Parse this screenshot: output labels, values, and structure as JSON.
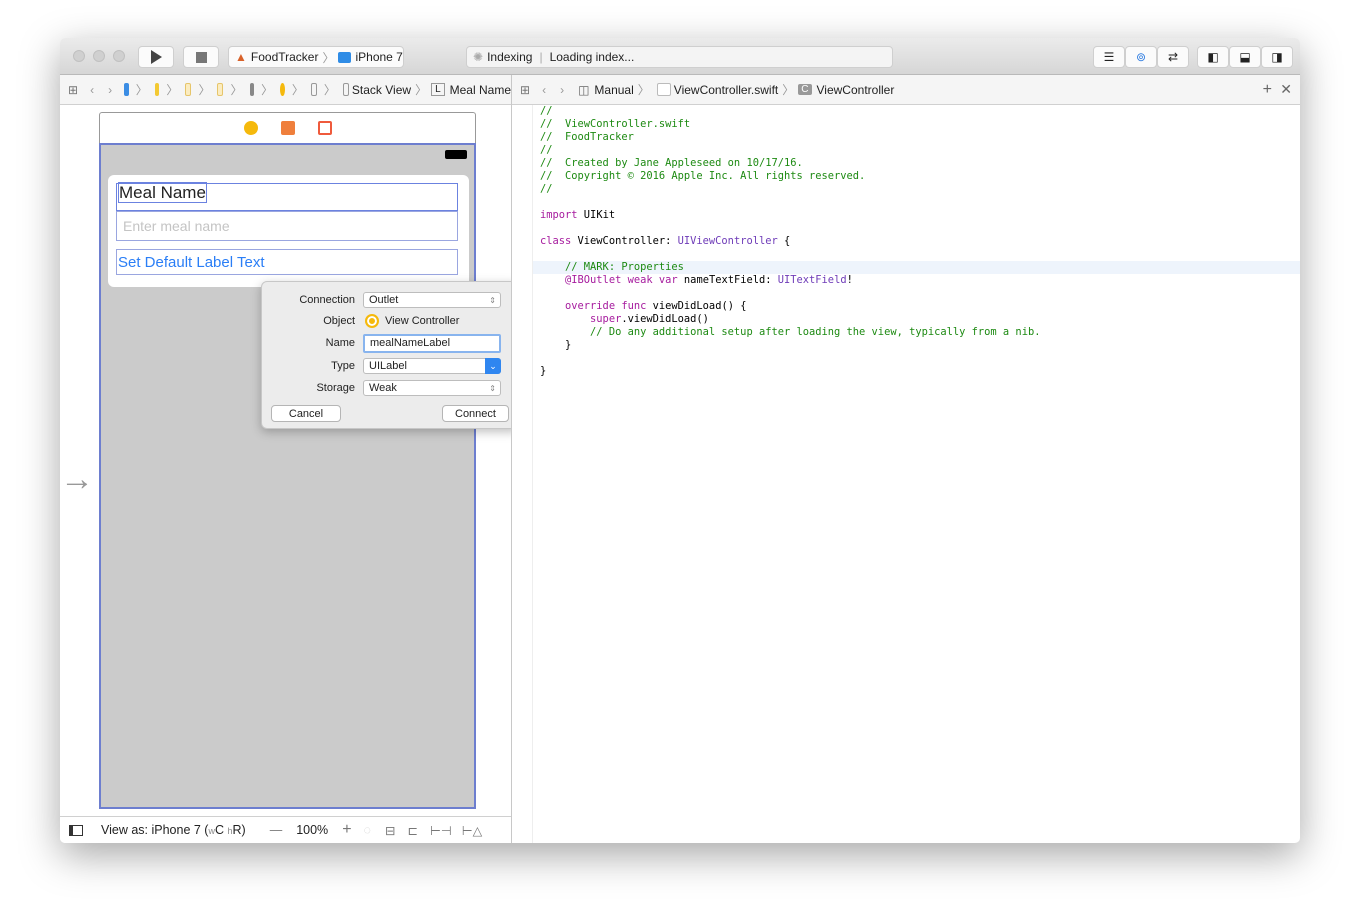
{
  "toolbar": {
    "scheme": "FoodTracker",
    "device": "iPhone 7",
    "activity_status": "Indexing",
    "activity_message": "Loading index..."
  },
  "left_jumpbar": {
    "items": [
      "Stack View",
      "Meal Name"
    ],
    "label_badge": "L"
  },
  "right_jumpbar": {
    "items": [
      "Manual",
      "ViewController.swift",
      "ViewController"
    ],
    "class_badge": "C"
  },
  "canvas": {
    "meal_name_label": "Meal Name",
    "text_field_placeholder": "Enter meal name",
    "button_label": "Set Default Label Text"
  },
  "popup": {
    "connection_label": "Connection",
    "connection_value": "Outlet",
    "object_label": "Object",
    "object_value": "View Controller",
    "name_label": "Name",
    "name_value": "mealNameLabel",
    "type_label": "Type",
    "type_value": "UILabel",
    "storage_label": "Storage",
    "storage_value": "Weak",
    "cancel": "Cancel",
    "connect": "Connect"
  },
  "bottom_bar": {
    "view_as": "View as: iPhone 7 (",
    "w": "w",
    "c": "C ",
    "h": "h",
    "r": "R)",
    "zoom": "100%"
  },
  "code_lines": [
    [
      [
        "//",
        "cm"
      ]
    ],
    [
      [
        "//  ViewController.swift",
        "cm"
      ]
    ],
    [
      [
        "//  FoodTracker",
        "cm"
      ]
    ],
    [
      [
        "//",
        "cm"
      ]
    ],
    [
      [
        "//  Created by Jane Appleseed on 10/17/16.",
        "cm"
      ]
    ],
    [
      [
        "//  Copyright © 2016 Apple Inc. All rights reserved.",
        "cm"
      ]
    ],
    [
      [
        "//",
        "cm"
      ]
    ],
    [],
    [
      [
        "import",
        "kw"
      ],
      [
        " UIKit",
        "pl"
      ]
    ],
    [],
    [
      [
        "class",
        "kw"
      ],
      [
        " ViewController: ",
        "pl"
      ],
      [
        "UIViewController",
        "ty"
      ],
      [
        " {",
        "pl"
      ]
    ],
    [],
    [
      [
        "    // MARK: Properties",
        "cm"
      ]
    ],
    [
      [
        "    @IBOutlet",
        "kw"
      ],
      [
        " ",
        "pl"
      ],
      [
        "weak",
        "kw"
      ],
      [
        " ",
        "pl"
      ],
      [
        "var",
        "kw"
      ],
      [
        " nameTextField: ",
        "pl"
      ],
      [
        "UITextField",
        "ty"
      ],
      [
        "!",
        "pl"
      ]
    ],
    [],
    [
      [
        "    override",
        "kw"
      ],
      [
        " ",
        "pl"
      ],
      [
        "func",
        "kw"
      ],
      [
        " viewDidLoad() {",
        "pl"
      ]
    ],
    [
      [
        "        super",
        "kw"
      ],
      [
        ".viewDidLoad()",
        "pl"
      ]
    ],
    [
      [
        "        // Do any additional setup after loading the view, typically from a nib.",
        "cm"
      ]
    ],
    [
      [
        "    }",
        "pl"
      ]
    ],
    [],
    [
      [
        "}",
        "pl"
      ]
    ]
  ]
}
